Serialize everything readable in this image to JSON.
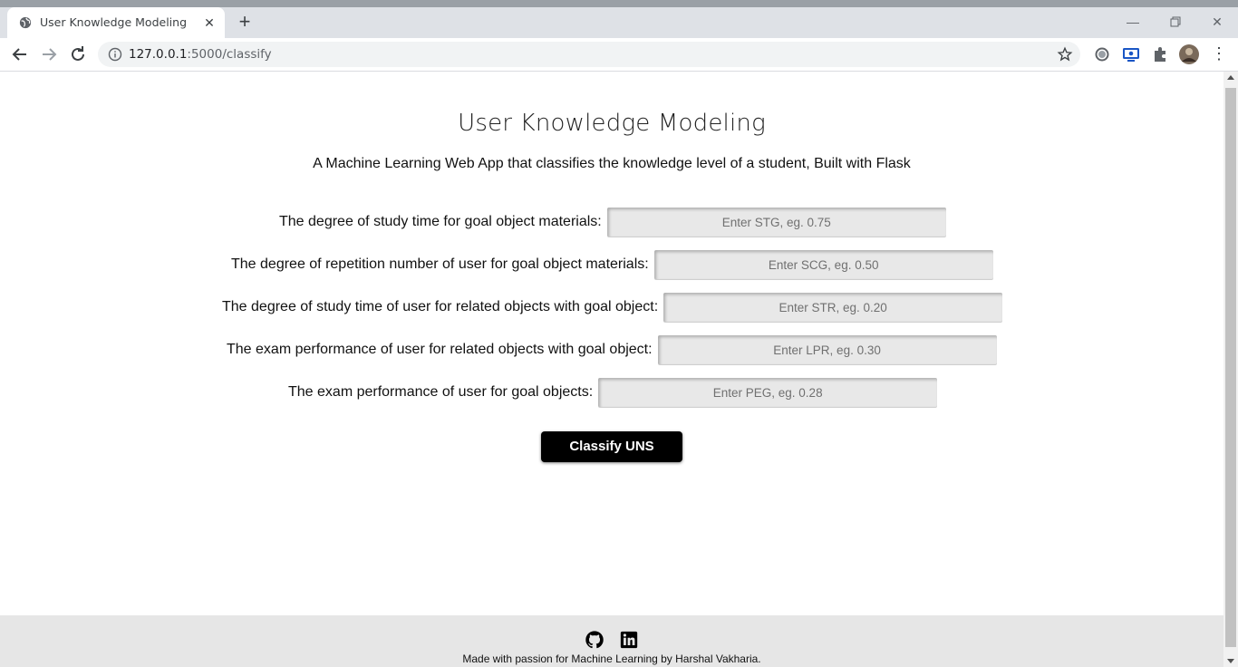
{
  "browser": {
    "tab_title": "User Knowledge Modeling",
    "url_host": "127.0.0.1",
    "url_path": ":5000/classify"
  },
  "page": {
    "title": "User Knowledge Modeling",
    "subtitle": "A Machine Learning Web App that classifies the knowledge level of a student, Built with Flask",
    "fields": [
      {
        "label": "The degree of study time for goal object materials:",
        "placeholder": "Enter STG, eg. 0.75",
        "value": ""
      },
      {
        "label": "The degree of repetition number of user for goal object materials:",
        "placeholder": "Enter SCG, eg. 0.50",
        "value": ""
      },
      {
        "label": "The degree of study time of user for related objects with goal object:",
        "placeholder": "Enter STR, eg. 0.20",
        "value": ""
      },
      {
        "label": "The exam performance of user for related objects with goal object:",
        "placeholder": "Enter LPR, eg. 0.30",
        "value": ""
      },
      {
        "label": "The exam performance of user for goal objects:",
        "placeholder": "Enter PEG, eg. 0.28",
        "value": ""
      }
    ],
    "submit_label": "Classify UNS"
  },
  "footer": {
    "icons": [
      "github-icon",
      "linkedin-icon"
    ],
    "text": "Made with passion for Machine Learning by Harshal Vakharia."
  }
}
